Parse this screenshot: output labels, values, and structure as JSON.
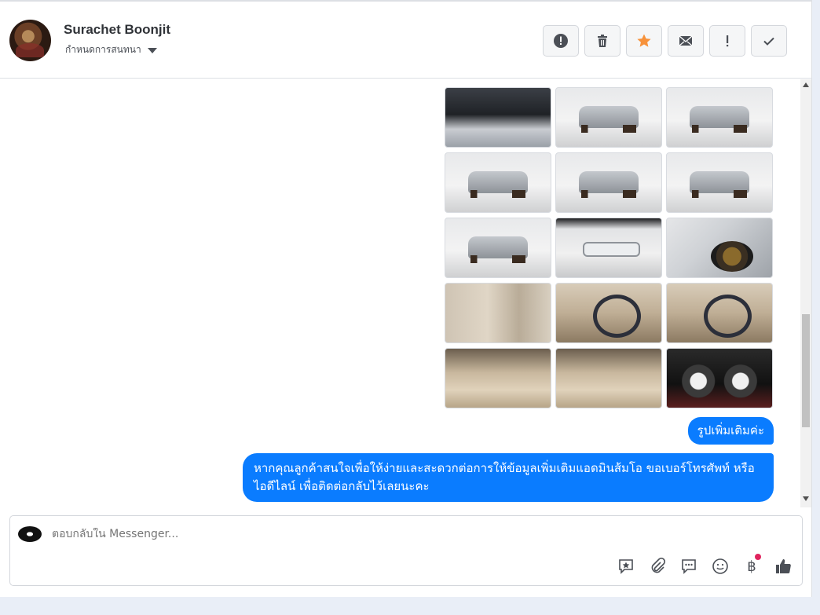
{
  "header": {
    "contact_name": "Surachet Boonjit",
    "assign_label": "กำหนดการสนทนา",
    "toolbar": [
      {
        "name": "spam-button",
        "icon": "alert-circle-icon"
      },
      {
        "name": "delete-button",
        "icon": "trash-icon"
      },
      {
        "name": "star-button",
        "icon": "star-icon",
        "color": "#f7923b"
      },
      {
        "name": "mark-unread-button",
        "icon": "envelope-icon"
      },
      {
        "name": "follow-up-button",
        "icon": "exclamation-icon"
      },
      {
        "name": "done-button",
        "icon": "check-icon"
      }
    ]
  },
  "photos": [
    {
      "kind": "engine-bay"
    },
    {
      "kind": "front-quarter"
    },
    {
      "kind": "front"
    },
    {
      "kind": "front-quarter-left"
    },
    {
      "kind": "rear-quarter"
    },
    {
      "kind": "rear"
    },
    {
      "kind": "rear-quarter-left"
    },
    {
      "kind": "side-wide"
    },
    {
      "kind": "wheel-closeup"
    },
    {
      "kind": "door-panel"
    },
    {
      "kind": "dashboard"
    },
    {
      "kind": "steering-wheel"
    },
    {
      "kind": "seats-front"
    },
    {
      "kind": "seats-rear"
    },
    {
      "kind": "instrument-cluster"
    }
  ],
  "messages": [
    {
      "text": "รูปเพิ่มเติมค่ะ"
    },
    {
      "text": "หากคุณลูกค้าสนใจเพื่อให้ง่ายและสะดวกต่อการให้ข้อมูลเพิ่มเติมแอดมินส้มโอ ขอเบอร์โทรศัพท์ หรือ ไอดีไลน์ เพื่อติดต่อกลับไว้เลยนะคะ"
    }
  ],
  "composer": {
    "placeholder": "ตอบกลับใน Messenger...",
    "tools": [
      "saved-reply-icon",
      "attachment-icon",
      "chat-icon",
      "emoji-icon",
      "payment-baht-icon",
      "like-icon"
    ],
    "baht_symbol": "฿"
  },
  "colors": {
    "accent": "#0a7cff",
    "star": "#f7923b",
    "notification": "#e0245e"
  }
}
